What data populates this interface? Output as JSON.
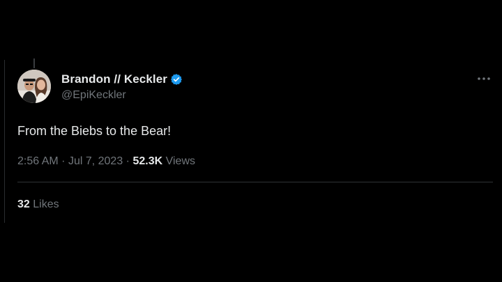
{
  "theme": {
    "background": "#000000",
    "text_primary": "#e7e9ea",
    "text_secondary": "#71767b",
    "divider": "#2f3336",
    "verified_badge": "#1d9bf0"
  },
  "tweet": {
    "author": {
      "display_name": "Brandon // Keckler",
      "handle": "@EpiKeckler",
      "verified": true,
      "avatar_icon": "avatar-photo"
    },
    "text": "From the Biebs to the Bear!",
    "meta": {
      "time": "2:56 AM",
      "separator": "·",
      "date": "Jul 7, 2023",
      "views_count": "52.3K",
      "views_label": "Views"
    },
    "stats": {
      "likes_count": "32",
      "likes_label": "Likes"
    },
    "more_icon": "more-horizontal-icon"
  }
}
